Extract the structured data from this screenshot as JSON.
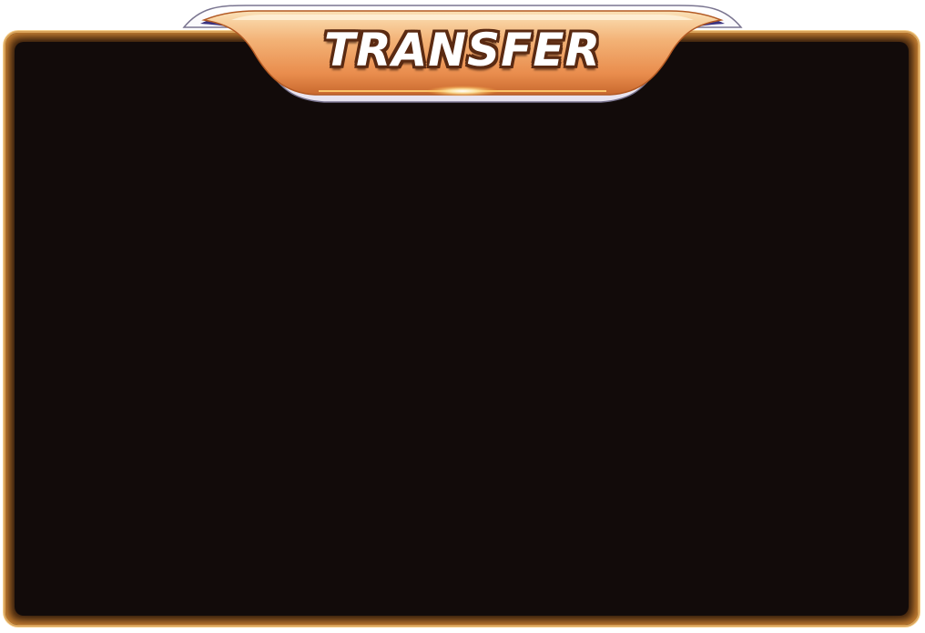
{
  "banner": {
    "title": "TRANSFER"
  },
  "colors": {
    "panel_background": "#110a09",
    "panel_glow": "#e6963c",
    "banner_gold": "#f0a868",
    "banner_edge": "#3a3280"
  }
}
